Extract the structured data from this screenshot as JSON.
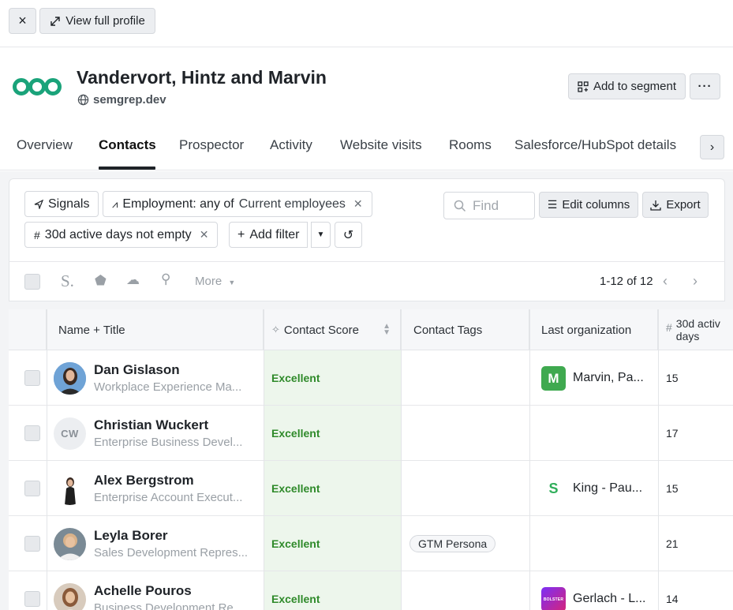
{
  "topbar": {
    "close_label": "×",
    "profile_label": "View full profile"
  },
  "company": {
    "name": "Vandervort, Hintz and Marvin",
    "domain": "semgrep.dev"
  },
  "actions": {
    "segment_label": "Add to segment",
    "more_label": "···"
  },
  "tabs": [
    {
      "label": "Overview"
    },
    {
      "label": "Contacts",
      "active": true
    },
    {
      "label": "Prospector"
    },
    {
      "label": "Activity"
    },
    {
      "label": "Website visits"
    },
    {
      "label": "Rooms"
    },
    {
      "label": "Salesforce/HubSpot details"
    }
  ],
  "filters": {
    "signals_label": "Signals",
    "employment_prefix": "Employment: any of",
    "employment_value": "Current employees",
    "active_days_label": "30d active days not empty",
    "add_filter_label": "Add filter",
    "find_placeholder": "Find  ",
    "edit_columns_label": "Edit columns",
    "export_label": "Export"
  },
  "toolbar": {
    "more_label": "More",
    "pagination": "1-12 of 12"
  },
  "columns": {
    "name": "Name + Title",
    "score": "Contact Score",
    "tags": "Contact Tags",
    "org": "Last organization",
    "days_line1": "30d activ",
    "days_line2": "days"
  },
  "contacts": [
    {
      "name": "Dan Gislason",
      "title": "Workplace Experience Ma...",
      "score": "Excellent",
      "tag": "",
      "org": "Marvin, Pa...",
      "org_logo": "M",
      "days": "15",
      "initials": ""
    },
    {
      "name": "Christian Wuckert",
      "title": "Enterprise Business Devel...",
      "score": "Excellent",
      "tag": "",
      "org": "",
      "org_logo": "",
      "days": "17",
      "initials": "CW"
    },
    {
      "name": "Alex Bergstrom",
      "title": "Enterprise Account Execut...",
      "score": "Excellent",
      "tag": "",
      "org": "King - Pau...",
      "org_logo": "S",
      "days": "15",
      "initials": ""
    },
    {
      "name": "Leyla Borer",
      "title": "Sales Development Repres...",
      "score": "Excellent",
      "tag": "GTM Persona",
      "org": "",
      "org_logo": "",
      "days": "21",
      "initials": ""
    },
    {
      "name": "Achelle Pouros",
      "title": "Business Development Re...",
      "score": "Excellent",
      "tag": "",
      "org": "Gerlach - L...",
      "org_logo": "BOLSTER",
      "days": "14",
      "initials": ""
    }
  ],
  "colors": {
    "accent_green": "#2f8a2a",
    "logo_teal": "#1aa37a",
    "score_bg": "#edf6ec"
  }
}
